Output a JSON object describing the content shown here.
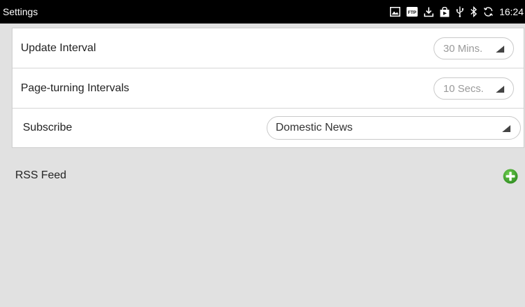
{
  "statusbar": {
    "title": "Settings",
    "clock": "16:24",
    "icons": [
      "image-icon",
      "ftp-icon",
      "download-icon",
      "store-icon",
      "usb-icon",
      "bluetooth-icon",
      "sync-icon"
    ]
  },
  "settings": {
    "update_interval": {
      "label": "Update Interval",
      "value": "30 Mins."
    },
    "page_turning": {
      "label": "Page-turning Intervals",
      "value": "10 Secs."
    },
    "subscribe": {
      "label": "Subscribe",
      "value": "Domestic News"
    }
  },
  "rss": {
    "label": "RSS Feed",
    "add_icon": "add-circle-icon",
    "add_color": "#3a9a2a"
  },
  "colors": {
    "statusbar_bg": "#000000",
    "page_bg": "#e1e1e1",
    "card_bg": "#ffffff"
  }
}
